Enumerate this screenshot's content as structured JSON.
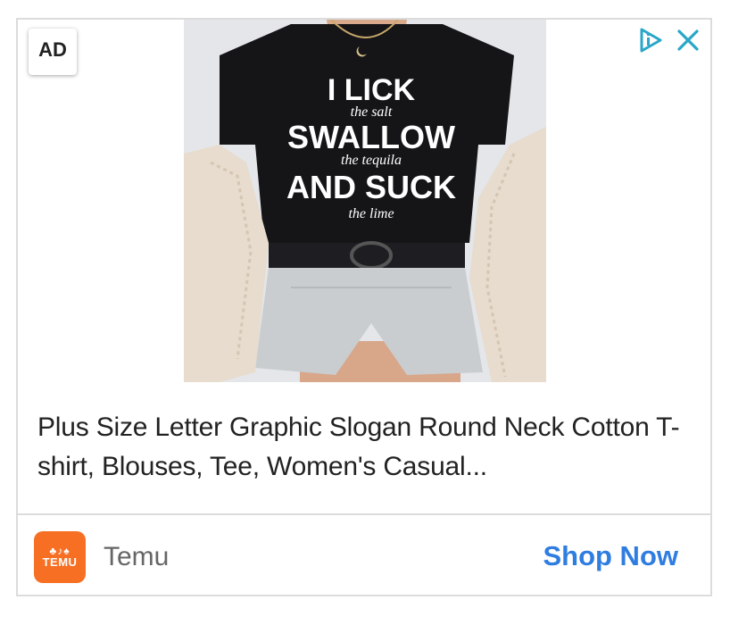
{
  "ad_badge": {
    "label": "AD"
  },
  "top_icons": {
    "adchoices": "adchoices-icon",
    "close": "close-icon"
  },
  "product": {
    "image_alt": "black graphic t-shirt with slogan",
    "shirt_lines": [
      "I LICK",
      "the salt",
      "SWALLOW",
      "the tequila",
      "AND SUCK",
      "the lime"
    ],
    "title": "Plus Size Letter Graphic Slogan Round Neck Cotton T-shirt, Blouses, Tee, Women's Casual..."
  },
  "footer": {
    "brand_logo_text": "TEMU",
    "brand_name": "Temu",
    "cta_label": "Shop Now"
  },
  "colors": {
    "cta": "#2f7de1",
    "brand": "#f76f22",
    "adchoices": "#2aa7c8"
  }
}
